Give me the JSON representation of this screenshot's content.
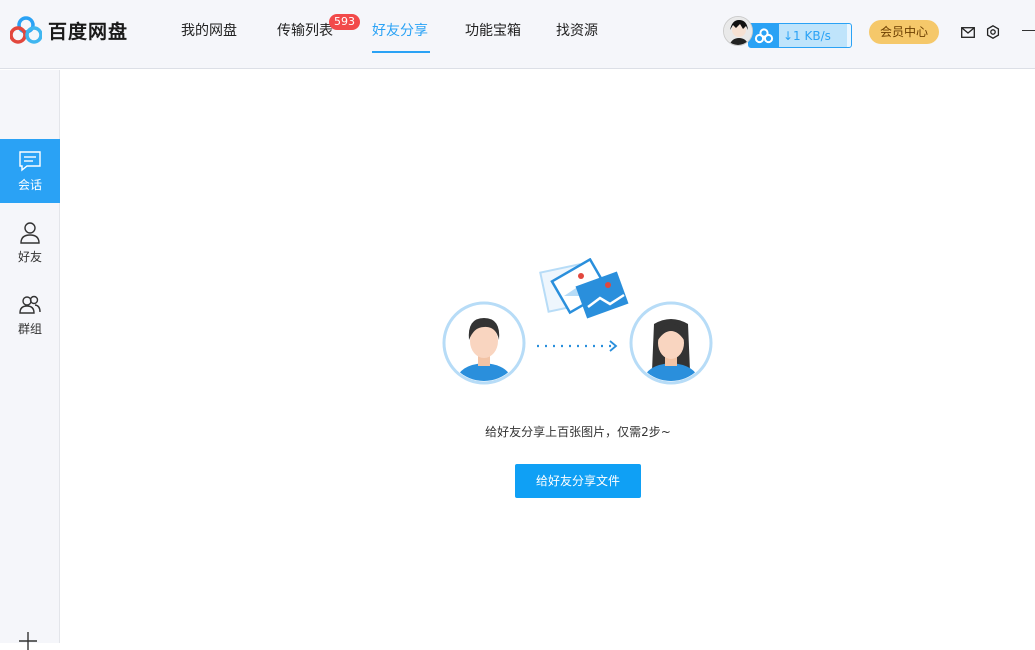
{
  "app": {
    "logo_text": "百度网盘"
  },
  "nav": {
    "tabs": [
      {
        "label": "我的网盘"
      },
      {
        "label": "传输列表",
        "badge": "593"
      },
      {
        "label": "好友分享",
        "active": true
      },
      {
        "label": "功能宝箱"
      },
      {
        "label": "找资源"
      }
    ]
  },
  "header": {
    "speed": "↓1 KB/s",
    "vip_label": "会员中心",
    "icons": [
      "mail-icon",
      "settings-icon",
      "minimize-icon"
    ]
  },
  "sidebar": {
    "items": [
      {
        "label": "会话",
        "icon": "chat-icon",
        "active": true
      },
      {
        "label": "好友",
        "icon": "person-icon"
      },
      {
        "label": "群组",
        "icon": "group-icon"
      }
    ]
  },
  "main": {
    "hint": "给好友分享上百张图片，仅需2步~",
    "button_label": "给好友分享文件"
  },
  "colors": {
    "accent": "#2aa2f5",
    "badge": "#f24a4a",
    "vip": "#f5c86a"
  }
}
